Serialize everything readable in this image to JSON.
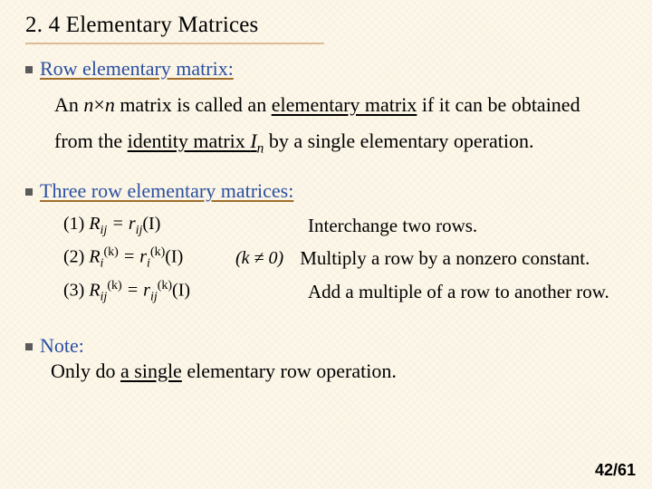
{
  "heading": "2. 4 Elementary Matrices",
  "term1": "Row elementary matrix:",
  "body": {
    "l1a": "An ",
    "l1b": "n",
    "l1c": "×",
    "l1d": "n",
    "l1e": " matrix is called an ",
    "l1f": "elementary matrix",
    "l1g": " if it can be obtained",
    "l2a": "from the ",
    "l2b": "identity matrix ",
    "l2c": "I",
    "l2d": "n",
    "l2e": "  by a single elementary operation."
  },
  "term2": "Three row elementary matrices:",
  "eq": {
    "e1_num": "(1) ",
    "e1_lhs": "R",
    "e1_sub": "ij",
    "e1_mid": " = r",
    "e1_msub": "ij",
    "e1_arg": "(I)",
    "d1": "Interchange two rows.",
    "e2_num": "(2) ",
    "e2_lhs": "R",
    "e2_sub": "i",
    "e2_sup": "(k)",
    "e2_mid": " = r",
    "e2_msub": "i",
    "e2_msup": "(k)",
    "e2_arg": "(I)",
    "cond": "(k ≠ 0)",
    "d2": "Multiply a row by a nonzero constant.",
    "e3_num": "(3) ",
    "e3_lhs": "R",
    "e3_sub": "ij",
    "e3_sup": "(k)",
    "e3_mid": " = r",
    "e3_msub": "ij",
    "e3_msup": "(k)",
    "e3_arg": "(I)",
    "d3": "Add a multiple of a row to another row."
  },
  "note": {
    "label": "Note:",
    "pre": "Only do ",
    "ul": "a single",
    "post": " elementary row operation."
  },
  "page_num": "42/61"
}
